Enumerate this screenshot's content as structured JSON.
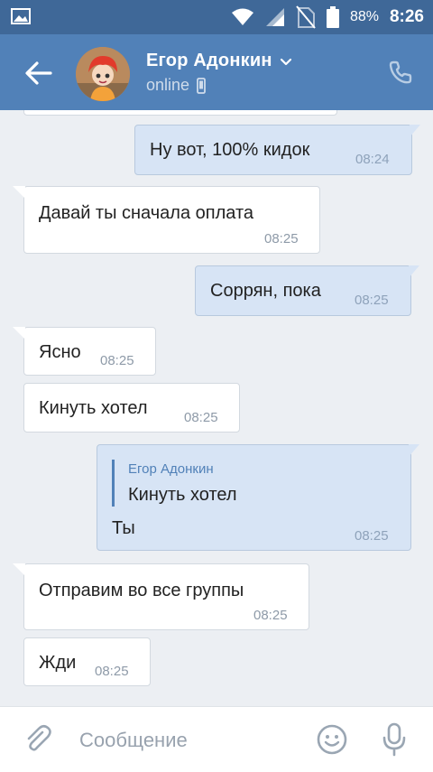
{
  "status_bar": {
    "battery_percent": "88%",
    "time": "8:26"
  },
  "header": {
    "contact_name": "Егор Адонкин",
    "status": "online"
  },
  "messages": [
    {
      "direction": "out",
      "text": "Ну вот, 100% кидок",
      "time": "08:24"
    },
    {
      "direction": "in",
      "text": "Давай ты сначала оплата",
      "time": "08:25"
    },
    {
      "direction": "out",
      "text": "Соррян, пока",
      "time": "08:25"
    },
    {
      "direction": "in",
      "text": "Ясно",
      "time": "08:25"
    },
    {
      "direction": "in",
      "text": "Кинуть хотел",
      "time": "08:25"
    },
    {
      "direction": "out",
      "reply_to_name": "Егор Адонкин",
      "reply_to_text": "Кинуть хотел",
      "text": "Ты",
      "time": "08:25"
    },
    {
      "direction": "in",
      "text": "Отправим во все группы",
      "time": "08:25"
    },
    {
      "direction": "in",
      "text": "Жди",
      "time": "08:25"
    }
  ],
  "composer": {
    "placeholder": "Сообщение"
  },
  "icons": {
    "back": "back-arrow-icon",
    "dropdown": "chevron-down-icon",
    "mobile": "mobile-phone-icon",
    "call": "phone-icon",
    "attach": "paperclip-icon",
    "emoji": "emoji-icon",
    "voice": "microphone-icon"
  },
  "colors": {
    "header_bg": "#5181b8",
    "status_bar_bg": "#3f6898",
    "chat_bg": "#eceff3",
    "outgoing_bubble": "#d7e4f5",
    "incoming_bubble": "#ffffff",
    "accent": "#5181b8"
  }
}
